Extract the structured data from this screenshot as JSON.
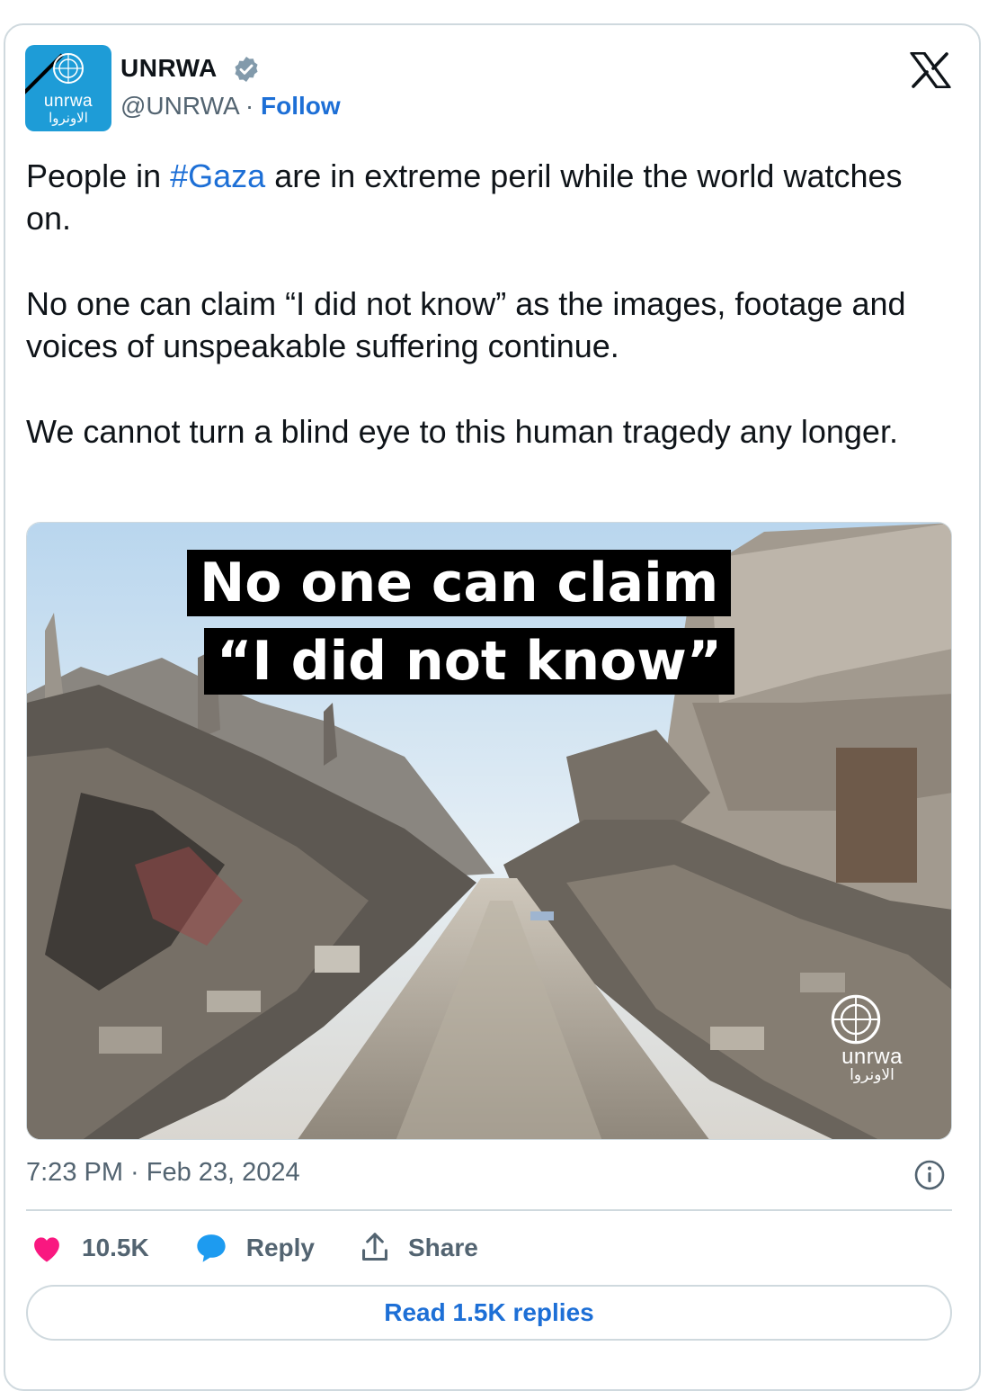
{
  "author": {
    "name": "UNRWA",
    "handle": "@UNRWA",
    "separator": "·",
    "follow_label": "Follow",
    "avatar_text_en": "unrwa",
    "avatar_text_ar": "الاونروا"
  },
  "tweet": {
    "p1_prefix": "People in ",
    "p1_hashtag": "#Gaza",
    "p1_suffix": " are in extreme peril while the world watches on.",
    "p2": "No one can claim “I did not know” as the images, footage and voices of unspeakable suffering continue.",
    "p3": "We cannot turn a blind eye to this human tragedy any longer."
  },
  "media": {
    "overlay_line1": "No one can claim",
    "overlay_line2": "“I did not know”",
    "watermark_en": "unrwa",
    "watermark_ar": "الاونروا"
  },
  "timestamp": "7:23 PM · Feb 23, 2024",
  "actions": {
    "like_count": "10.5K",
    "reply_label": "Reply",
    "share_label": "Share"
  },
  "read_replies_label": "Read 1.5K replies",
  "colors": {
    "link_blue": "#1d6fd6",
    "like_pink": "#f91880",
    "reply_blue": "#1d9bf0",
    "avatar_bg": "#1e9cd7"
  },
  "icons": [
    "verified-badge-icon",
    "x-logo-icon",
    "info-icon",
    "heart-icon",
    "reply-bubble-icon",
    "share-icon",
    "un-emblem-icon"
  ]
}
